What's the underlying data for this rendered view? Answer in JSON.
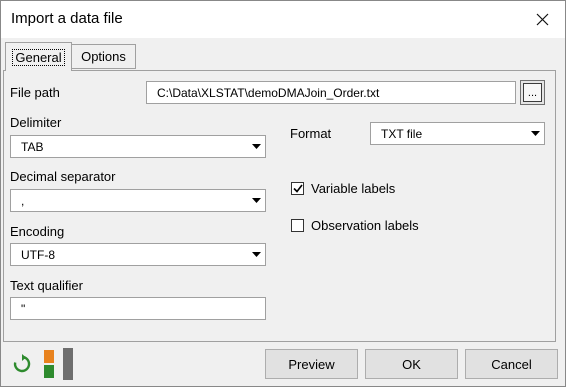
{
  "window": {
    "title": "Import a data file"
  },
  "tabs": [
    {
      "label": "General",
      "active": true
    },
    {
      "label": "Options",
      "active": false
    }
  ],
  "general": {
    "file_path": {
      "label": "File path",
      "value": "C:\\Data\\XLSTAT\\demoDMAJoin_Order.txt",
      "browse_label": "..."
    },
    "delimiter": {
      "label": "Delimiter",
      "value": "TAB"
    },
    "decimal_separator": {
      "label": "Decimal separator",
      "value": ","
    },
    "encoding": {
      "label": "Encoding",
      "value": "UTF-8"
    },
    "text_qualifier": {
      "label": "Text qualifier",
      "value": "\""
    },
    "format": {
      "label": "Format",
      "value": "TXT file"
    },
    "variable_labels": {
      "label": "Variable labels",
      "checked": true
    },
    "observation_labels": {
      "label": "Observation labels",
      "checked": false
    }
  },
  "footer": {
    "preview_label": "Preview",
    "ok_label": "OK",
    "cancel_label": "Cancel"
  },
  "colors": {
    "refresh_icon": "#2e8b2e",
    "layout_icon_orange": "#e8821e",
    "layout_icon_green": "#2e8b2e",
    "layout_icon_gray": "#6e6e6e"
  }
}
